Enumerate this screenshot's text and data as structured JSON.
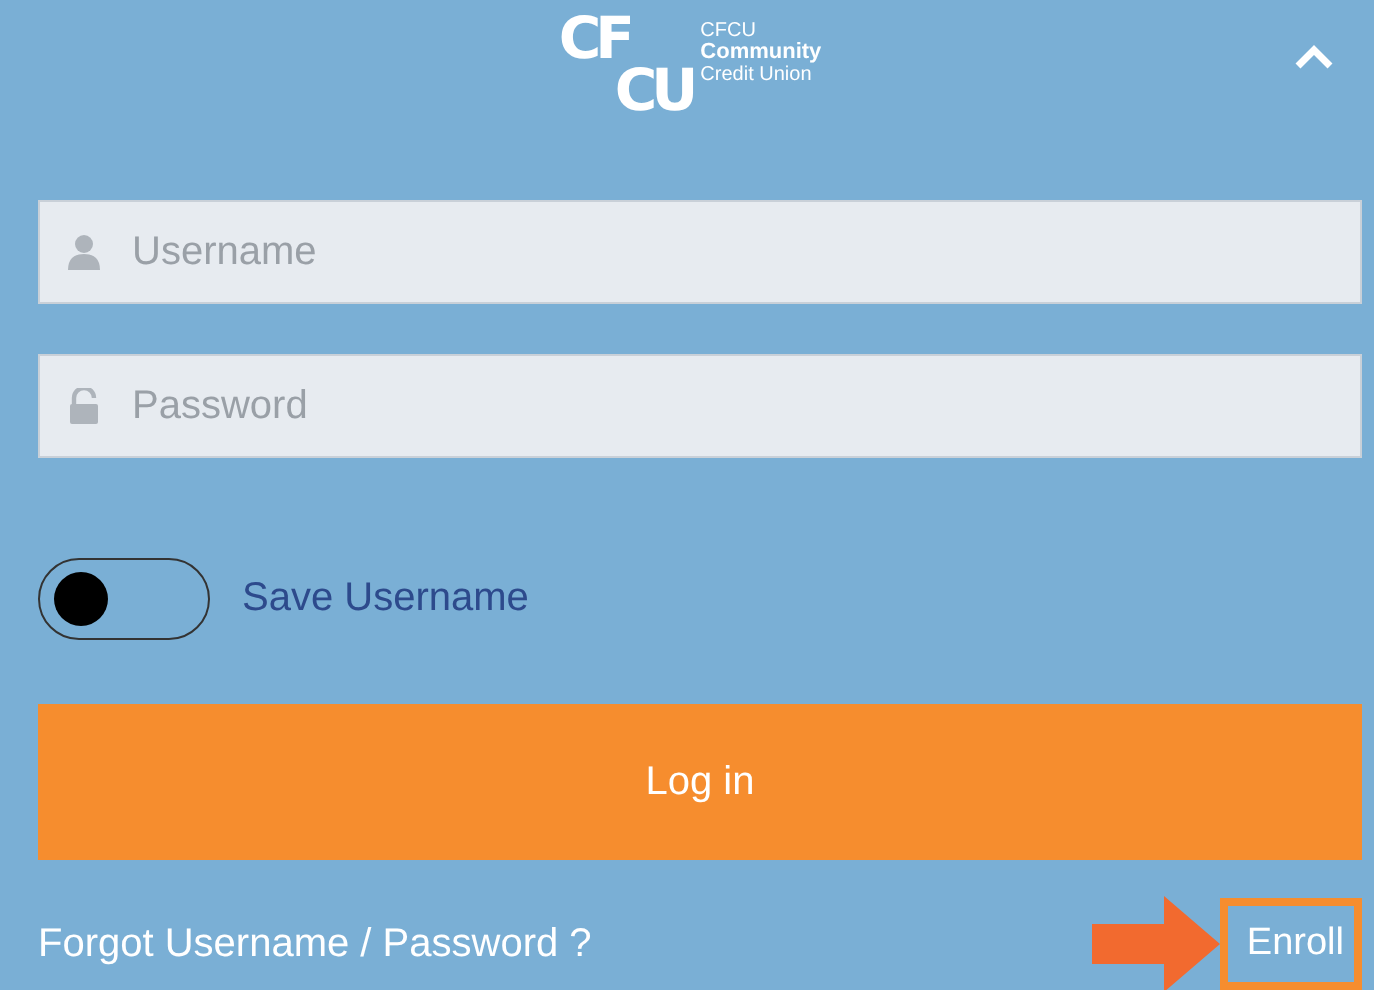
{
  "logo": {
    "monogram_top": "CF",
    "monogram_bottom": "CU",
    "line_1": "CFCU",
    "line_2": "Community",
    "line_3": "Credit Union"
  },
  "header": {
    "expanded": true
  },
  "fields": [
    {
      "kind": "user",
      "placeholder": "Username"
    },
    {
      "kind": "lock",
      "placeholder": "Password"
    }
  ],
  "save_toggle": {
    "label": "Save Username",
    "on": false
  },
  "login_button": "Log in",
  "links": {
    "forgot": "Forgot Username / Password ?",
    "enroll": "Enroll",
    "enroll_highlighted": true
  }
}
